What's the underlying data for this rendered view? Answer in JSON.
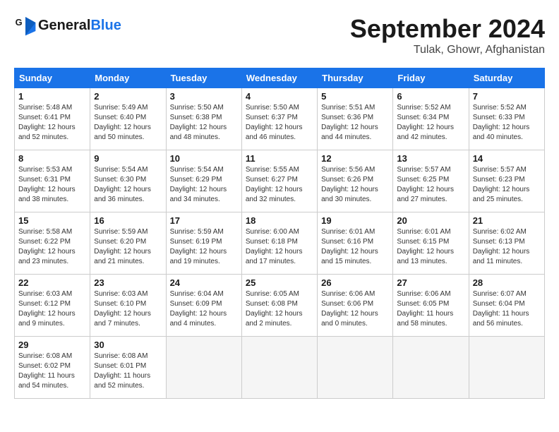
{
  "header": {
    "logo_line1": "General",
    "logo_line2": "Blue",
    "title": "September 2024",
    "subtitle": "Tulak, Ghowr, Afghanistan"
  },
  "weekdays": [
    "Sunday",
    "Monday",
    "Tuesday",
    "Wednesday",
    "Thursday",
    "Friday",
    "Saturday"
  ],
  "weeks": [
    [
      {
        "day": "1",
        "text": "Sunrise: 5:48 AM\nSunset: 6:41 PM\nDaylight: 12 hours\nand 52 minutes."
      },
      {
        "day": "2",
        "text": "Sunrise: 5:49 AM\nSunset: 6:40 PM\nDaylight: 12 hours\nand 50 minutes."
      },
      {
        "day": "3",
        "text": "Sunrise: 5:50 AM\nSunset: 6:38 PM\nDaylight: 12 hours\nand 48 minutes."
      },
      {
        "day": "4",
        "text": "Sunrise: 5:50 AM\nSunset: 6:37 PM\nDaylight: 12 hours\nand 46 minutes."
      },
      {
        "day": "5",
        "text": "Sunrise: 5:51 AM\nSunset: 6:36 PM\nDaylight: 12 hours\nand 44 minutes."
      },
      {
        "day": "6",
        "text": "Sunrise: 5:52 AM\nSunset: 6:34 PM\nDaylight: 12 hours\nand 42 minutes."
      },
      {
        "day": "7",
        "text": "Sunrise: 5:52 AM\nSunset: 6:33 PM\nDaylight: 12 hours\nand 40 minutes."
      }
    ],
    [
      {
        "day": "8",
        "text": "Sunrise: 5:53 AM\nSunset: 6:31 PM\nDaylight: 12 hours\nand 38 minutes."
      },
      {
        "day": "9",
        "text": "Sunrise: 5:54 AM\nSunset: 6:30 PM\nDaylight: 12 hours\nand 36 minutes."
      },
      {
        "day": "10",
        "text": "Sunrise: 5:54 AM\nSunset: 6:29 PM\nDaylight: 12 hours\nand 34 minutes."
      },
      {
        "day": "11",
        "text": "Sunrise: 5:55 AM\nSunset: 6:27 PM\nDaylight: 12 hours\nand 32 minutes."
      },
      {
        "day": "12",
        "text": "Sunrise: 5:56 AM\nSunset: 6:26 PM\nDaylight: 12 hours\nand 30 minutes."
      },
      {
        "day": "13",
        "text": "Sunrise: 5:57 AM\nSunset: 6:25 PM\nDaylight: 12 hours\nand 27 minutes."
      },
      {
        "day": "14",
        "text": "Sunrise: 5:57 AM\nSunset: 6:23 PM\nDaylight: 12 hours\nand 25 minutes."
      }
    ],
    [
      {
        "day": "15",
        "text": "Sunrise: 5:58 AM\nSunset: 6:22 PM\nDaylight: 12 hours\nand 23 minutes."
      },
      {
        "day": "16",
        "text": "Sunrise: 5:59 AM\nSunset: 6:20 PM\nDaylight: 12 hours\nand 21 minutes."
      },
      {
        "day": "17",
        "text": "Sunrise: 5:59 AM\nSunset: 6:19 PM\nDaylight: 12 hours\nand 19 minutes."
      },
      {
        "day": "18",
        "text": "Sunrise: 6:00 AM\nSunset: 6:18 PM\nDaylight: 12 hours\nand 17 minutes."
      },
      {
        "day": "19",
        "text": "Sunrise: 6:01 AM\nSunset: 6:16 PM\nDaylight: 12 hours\nand 15 minutes."
      },
      {
        "day": "20",
        "text": "Sunrise: 6:01 AM\nSunset: 6:15 PM\nDaylight: 12 hours\nand 13 minutes."
      },
      {
        "day": "21",
        "text": "Sunrise: 6:02 AM\nSunset: 6:13 PM\nDaylight: 12 hours\nand 11 minutes."
      }
    ],
    [
      {
        "day": "22",
        "text": "Sunrise: 6:03 AM\nSunset: 6:12 PM\nDaylight: 12 hours\nand 9 minutes."
      },
      {
        "day": "23",
        "text": "Sunrise: 6:03 AM\nSunset: 6:10 PM\nDaylight: 12 hours\nand 7 minutes."
      },
      {
        "day": "24",
        "text": "Sunrise: 6:04 AM\nSunset: 6:09 PM\nDaylight: 12 hours\nand 4 minutes."
      },
      {
        "day": "25",
        "text": "Sunrise: 6:05 AM\nSunset: 6:08 PM\nDaylight: 12 hours\nand 2 minutes."
      },
      {
        "day": "26",
        "text": "Sunrise: 6:06 AM\nSunset: 6:06 PM\nDaylight: 12 hours\nand 0 minutes."
      },
      {
        "day": "27",
        "text": "Sunrise: 6:06 AM\nSunset: 6:05 PM\nDaylight: 11 hours\nand 58 minutes."
      },
      {
        "day": "28",
        "text": "Sunrise: 6:07 AM\nSunset: 6:04 PM\nDaylight: 11 hours\nand 56 minutes."
      }
    ],
    [
      {
        "day": "29",
        "text": "Sunrise: 6:08 AM\nSunset: 6:02 PM\nDaylight: 11 hours\nand 54 minutes."
      },
      {
        "day": "30",
        "text": "Sunrise: 6:08 AM\nSunset: 6:01 PM\nDaylight: 11 hours\nand 52 minutes."
      },
      {
        "day": "",
        "text": ""
      },
      {
        "day": "",
        "text": ""
      },
      {
        "day": "",
        "text": ""
      },
      {
        "day": "",
        "text": ""
      },
      {
        "day": "",
        "text": ""
      }
    ]
  ]
}
